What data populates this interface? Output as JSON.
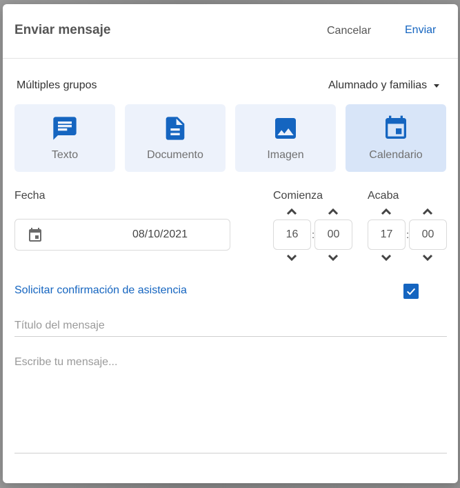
{
  "dialog": {
    "title": "Enviar mensaje",
    "cancel_label": "Cancelar",
    "send_label": "Enviar"
  },
  "recipients": {
    "groups_label": "Múltiples grupos",
    "audience_selected": "Alumnado y familias"
  },
  "message_types": [
    {
      "label": "Texto",
      "icon": "message-icon",
      "selected": false
    },
    {
      "label": "Documento",
      "icon": "document-icon",
      "selected": false
    },
    {
      "label": "Imagen",
      "icon": "image-icon",
      "selected": false
    },
    {
      "label": "Calendario",
      "icon": "calendar-icon",
      "selected": true
    }
  ],
  "event": {
    "date_label": "Fecha",
    "date_value": "08/10/2021",
    "start_label": "Comienza",
    "end_label": "Acaba",
    "start_hour": "16",
    "start_minute": "00",
    "end_hour": "17",
    "end_minute": "00",
    "separator": ":"
  },
  "confirmation": {
    "label": "Solicitar confirmación de asistencia",
    "checked": true
  },
  "compose": {
    "title_placeholder": "Título del mensaje",
    "title_value": "",
    "body_placeholder": "Escribe tu mensaje...",
    "body_value": ""
  },
  "colors": {
    "accent": "#1565c0",
    "tile_bg": "#edf2fb",
    "tile_selected_bg": "#d8e5f8"
  }
}
